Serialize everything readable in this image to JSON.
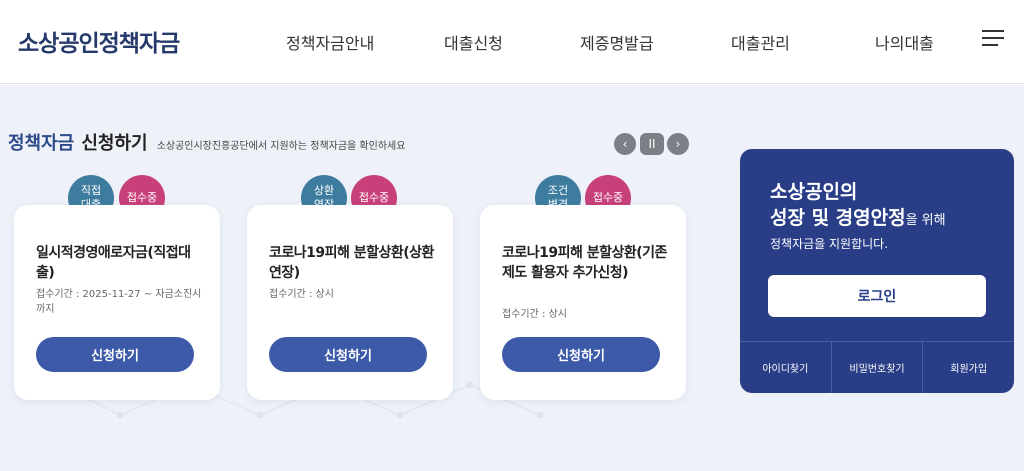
{
  "header": {
    "logo": "소상공인정책자금",
    "nav": [
      "정책자금안내",
      "대출신청",
      "제증명발급",
      "대출관리",
      "나의대출"
    ]
  },
  "section": {
    "title_part1": "정책자금",
    "title_part2": "신청하기",
    "subtitle": "소상공인시장진흥공단에서 지원하는 정책자금을 확인하세요"
  },
  "slider": {
    "prev": "‹",
    "pause": "II",
    "next": "›"
  },
  "cards": [
    {
      "type_line1": "직접",
      "type_line2": "대출",
      "status": "접수중",
      "title": "일시적경영애로자금(직접대출)",
      "date": "접수기간 : 2025-11-27 ~ 자금소진시까지",
      "button": "신청하기"
    },
    {
      "type_line1": "상환",
      "type_line2": "연장",
      "status": "접수중",
      "title": "코로나19피해 분할상환(상환연장)",
      "date": "접수기간 : 상시",
      "button": "신청하기"
    },
    {
      "type_line1": "조건",
      "type_line2": "변경",
      "status": "접수중",
      "title": "코로나19피해 분할상환(기존제도 활용자 추가신청)",
      "date": "접수기간 : 상시",
      "button": "신청하기"
    }
  ],
  "panel": {
    "line1": "소상공인의",
    "line2": "성장 및 경영안정",
    "line2_suffix": "을 위해",
    "line3": "정책자금을 지원합니다.",
    "login": "로그인",
    "links": [
      "아이디찾기",
      "비밀번호찾기",
      "회원가입"
    ]
  },
  "colors": {
    "brand": "#253a6b",
    "button": "#3d5aa9",
    "panel": "#2a3e88",
    "badge_type": "#3e7c9f",
    "badge_status": "#c8407a"
  }
}
